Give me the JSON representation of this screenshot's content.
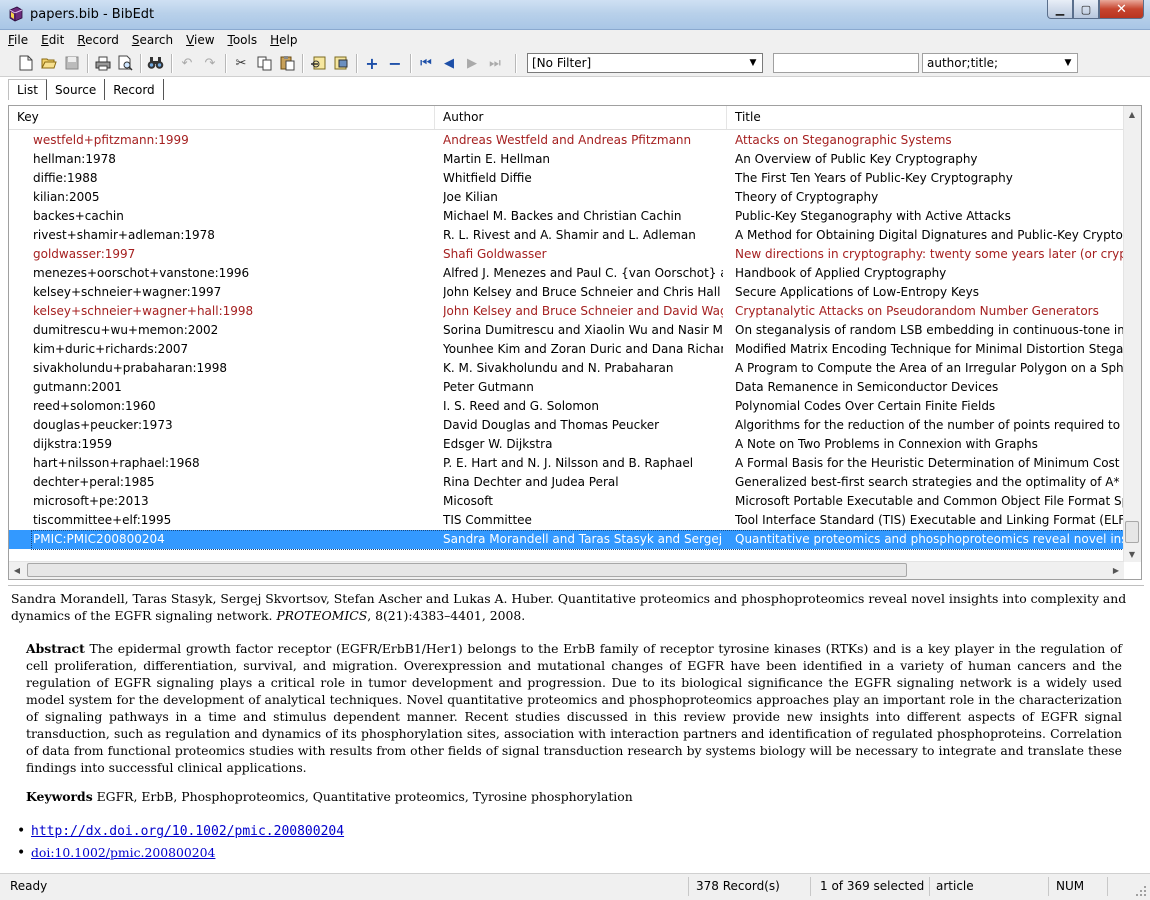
{
  "window": {
    "title": "papers.bib - BibEdt",
    "icon": "book-icon"
  },
  "menu": {
    "items": [
      {
        "first": "F",
        "rest": "ile"
      },
      {
        "first": "E",
        "rest": "dit"
      },
      {
        "first": "R",
        "rest": "ecord"
      },
      {
        "first": "S",
        "rest": "earch"
      },
      {
        "first": "V",
        "rest": "iew"
      },
      {
        "first": "T",
        "rest": "ools"
      },
      {
        "first": "H",
        "rest": "elp"
      }
    ]
  },
  "toolbar": {
    "filter_value": "[No Filter]",
    "search_value": "",
    "sort_value": "author;title;"
  },
  "tabs": [
    "List",
    "Source",
    "Record"
  ],
  "list": {
    "headers": {
      "key": "Key",
      "author": "Author",
      "title": "Title"
    },
    "rows": [
      {
        "key": "westfeld+pfitzmann:1999",
        "author": "Andreas Westfeld and Andreas Pfitzmann",
        "title": "Attacks on Steganographic Systems",
        "style": "red"
      },
      {
        "key": "hellman:1978",
        "author": "Martin E. Hellman",
        "title": "An Overview of Public Key Cryptography",
        "style": ""
      },
      {
        "key": "diffie:1988",
        "author": "Whitfield Diffie",
        "title": "The First Ten Years of Public-Key Cryptography",
        "style": ""
      },
      {
        "key": "kilian:2005",
        "author": "Joe Kilian",
        "title": "Theory of Cryptography",
        "style": ""
      },
      {
        "key": "backes+cachin",
        "author": "Michael M. Backes and Christian Cachin",
        "title": "Public-Key Steganography with Active Attacks",
        "style": ""
      },
      {
        "key": "rivest+shamir+adleman:1978",
        "author": "R. L. Rivest and A. Shamir and L. Adleman",
        "title": "A Method for Obtaining Digital Dignatures and Public-Key Cryptosystems",
        "style": ""
      },
      {
        "key": "goldwasser:1997",
        "author": "Shafi Goldwasser",
        "title": "New directions in cryptography: twenty some years later (or cryptography and complexity theory",
        "style": "red"
      },
      {
        "key": "menezes+oorschot+vanstone:1996",
        "author": "Alfred J. Menezes and Paul C. {van Oorschot} and S...",
        "title": "Handbook of Applied Cryptography",
        "style": ""
      },
      {
        "key": "kelsey+schneier+wagner:1997",
        "author": "John Kelsey and Bruce Schneier and Chris Hall and...",
        "title": "Secure Applications of Low-Entropy Keys",
        "style": ""
      },
      {
        "key": "kelsey+schneier+wagner+hall:1998",
        "author": "John Kelsey and Bruce Schneier and David Wagner ...",
        "title": "Cryptanalytic Attacks on Pseudorandom Number Generators",
        "style": "red"
      },
      {
        "key": "dumitrescu+wu+memon:2002",
        "author": "Sorina Dumitrescu and Xiaolin Wu and Nasir Memon",
        "title": "On steganalysis of random LSB embedding in continuous-tone images",
        "style": ""
      },
      {
        "key": "kim+duric+richards:2007",
        "author": "Younhee Kim and Zoran Duric and Dana Richards",
        "title": "Modified Matrix Encoding Technique for Minimal Distortion Steganography",
        "style": ""
      },
      {
        "key": "sivakholundu+prabaharan:1998",
        "author": "K. M. Sivakholundu and N. Prabaharan",
        "title": "A Program to Compute the Area of an Irregular Polygon on a Spherical Surface",
        "style": ""
      },
      {
        "key": "gutmann:2001",
        "author": "Peter Gutmann",
        "title": "Data Remanence in Semiconductor Devices",
        "style": ""
      },
      {
        "key": "reed+solomon:1960",
        "author": "I. S. Reed and G. Solomon",
        "title": "Polynomial Codes Over Certain Finite Fields",
        "style": ""
      },
      {
        "key": "douglas+peucker:1973",
        "author": "David Douglas and Thomas Peucker",
        "title": "Algorithms for the reduction of the number of points required to represent a digitized line",
        "style": ""
      },
      {
        "key": "dijkstra:1959",
        "author": "Edsger W. Dijkstra",
        "title": "A Note on Two Problems in Connexion with Graphs",
        "style": ""
      },
      {
        "key": "hart+nilsson+raphael:1968",
        "author": "P. E. Hart and N. J. Nilsson and B. Raphael",
        "title": "A Formal Basis for the Heuristic Determination of Minimum Cost Paths",
        "style": ""
      },
      {
        "key": "dechter+peral:1985",
        "author": "Rina Dechter and Judea Peral",
        "title": "Generalized best-first search strategies and the optimality of A*",
        "style": ""
      },
      {
        "key": "microsoft+pe:2013",
        "author": "Micosoft",
        "title": "Microsoft Portable Executable and Common Object File Format Specification",
        "style": ""
      },
      {
        "key": "tiscommittee+elf:1995",
        "author": "TIS Committee",
        "title": "Tool Interface Standard (TIS) Executable and Linking Format (ELF) Specification",
        "style": ""
      },
      {
        "key": "PMIC:PMIC200800204",
        "author": "Sandra Morandell and Taras Stasyk and Sergej Skvo...",
        "title": "Quantitative proteomics and phosphoproteomics reveal novel insights into complexity and dynamics",
        "style": "sel"
      }
    ]
  },
  "preview": {
    "authors": "Sandra Morandell, Taras Stasyk, Sergej Skvortsov, Stefan Ascher and Lukas A. Huber.",
    "title": " Quantitative proteomics and phosphoproteomics reveal novel insights into complexity and dynamics of the EGFR signaling network. ",
    "journal": "PROTEOMICS",
    "volume": ", 8(21):4383–4401, 2008.",
    "abstract_label": "Abstract",
    "abstract": " The epidermal growth factor receptor (EGFR/ErbB1/Her1) belongs to the ErbB family of receptor tyrosine kinases (RTKs) and is a key player in the regulation of cell proliferation, differentiation, survival, and migration. Overexpression and mutational changes of EGFR have been identified in a variety of human cancers and the regulation of EGFR signaling plays a critical role in tumor development and progression. Due to its biological significance the EGFR signaling network is a widely used model system for the development of analytical techniques. Novel quantitative proteomics and phosphoproteomics approaches play an important role in the characterization of signaling pathways in a time and stimulus dependent manner. Recent studies discussed in this review provide new insights into different aspects of EGFR signal transduction, such as regulation and dynamics of its phosphorylation sites, association with interaction partners and identification of regulated phosphoproteins. Correlation of data from functional proteomics studies with results from other fields of signal transduction research by systems biology will be necessary to integrate and translate these findings into successful clinical applications.",
    "keywords_label": "Keywords",
    "keywords": " EGFR, ErbB, Phosphoproteomics, Quantitative proteomics, Tyrosine phosphorylation",
    "url": "http://dx.doi.org/10.1002/pmic.200800204",
    "doi": "doi:10.1002/pmic.200800204"
  },
  "status": {
    "state": "Ready",
    "records": "378 Record(s)",
    "selected": "1 of 369 selected",
    "type": "article",
    "num": "NUM"
  },
  "colors": {
    "selection": "#3399ff",
    "marked_row": "#a52020",
    "link": "#0000cc"
  }
}
